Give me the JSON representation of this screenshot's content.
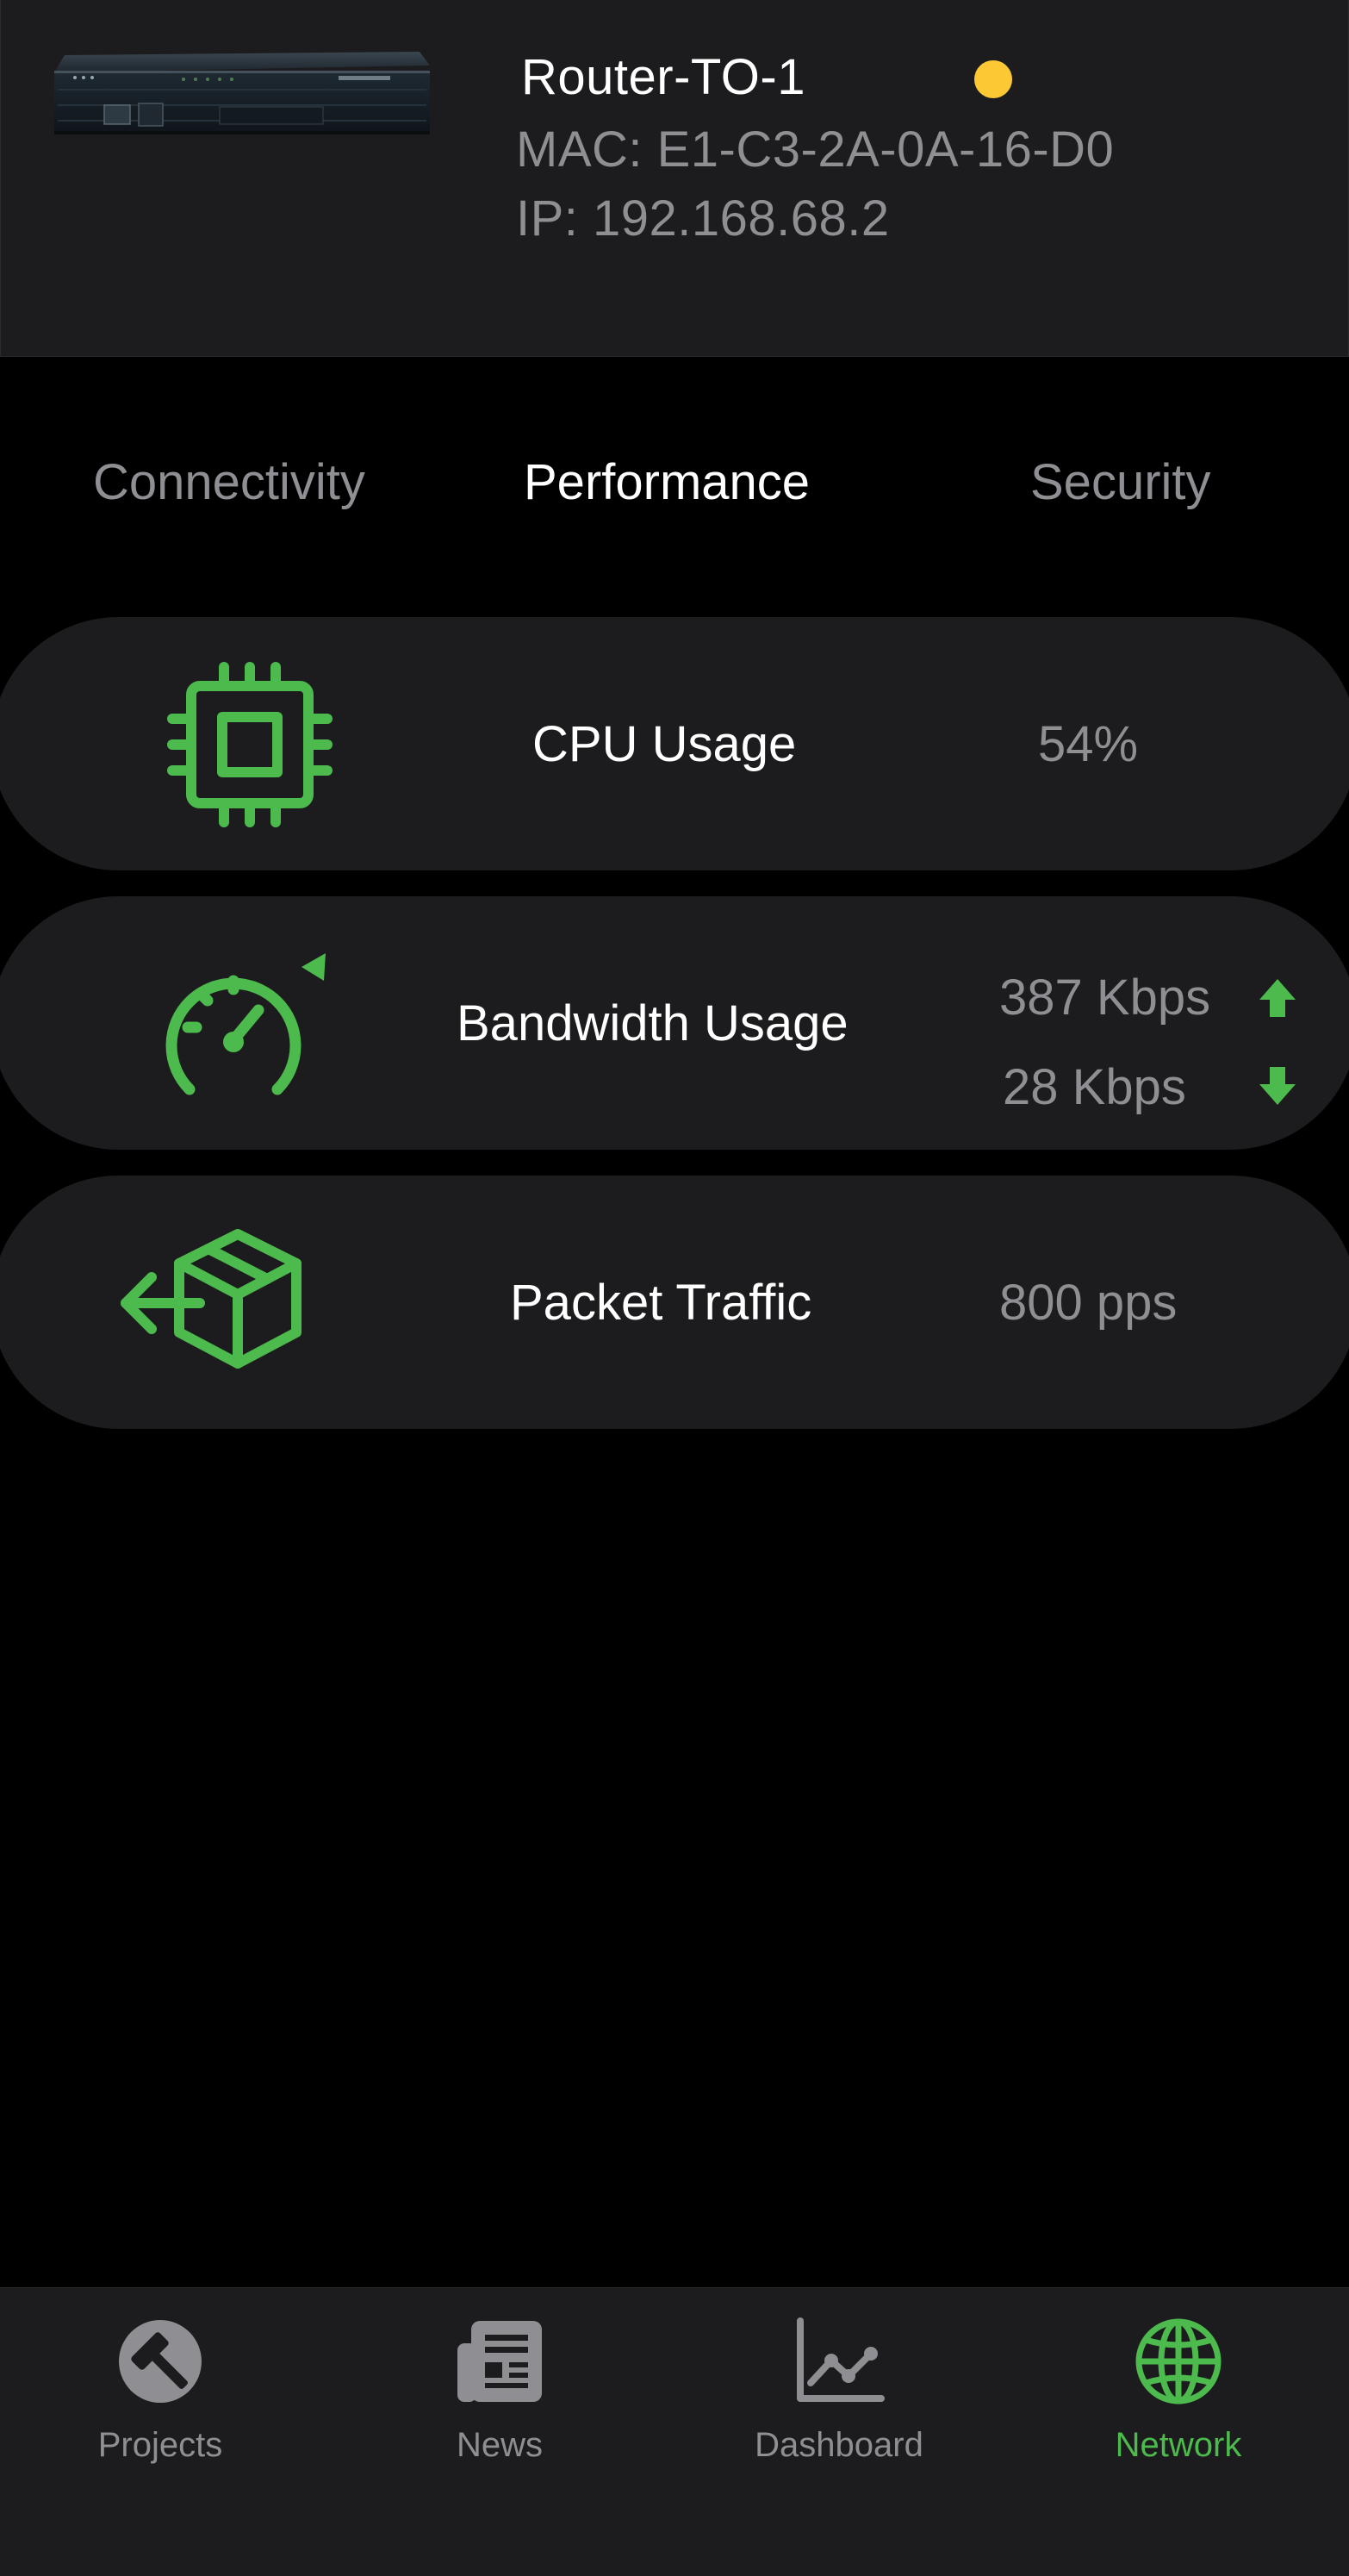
{
  "colors": {
    "accent": "#4cba4c",
    "status": "#fcc934",
    "background": "#000000",
    "surface": "#1c1c1e",
    "secondary_text": "#8e8e93"
  },
  "device": {
    "name": "Router-TO-1",
    "mac": "MAC: E1-C3-2A-0A-16-D0",
    "ip": "IP: 192.168.68.2",
    "status_color": "#fcc934",
    "image_icon": "router-device-image"
  },
  "tabs": [
    {
      "label": "Connectivity",
      "active": false
    },
    {
      "label": "Performance",
      "active": true
    },
    {
      "label": "Security",
      "active": false
    }
  ],
  "metrics": {
    "cpu": {
      "label": "CPU Usage",
      "value": "54%",
      "icon": "cpu-chip-icon"
    },
    "bandwidth": {
      "label": "Bandwidth Usage",
      "upload": "387 Kbps",
      "download": "28 Kbps",
      "icon": "speedometer-icon",
      "upload_icon": "arrow-up-icon",
      "download_icon": "arrow-down-icon"
    },
    "packet": {
      "label": "Packet Traffic",
      "value": "800 pps",
      "icon": "package-outgoing-icon"
    }
  },
  "tabbar": [
    {
      "label": "Projects",
      "icon": "hammer-icon",
      "active": false
    },
    {
      "label": "News",
      "icon": "newspaper-icon",
      "active": false
    },
    {
      "label": "Dashboard",
      "icon": "line-chart-icon",
      "active": false
    },
    {
      "label": "Network",
      "icon": "globe-icon",
      "active": true
    }
  ]
}
